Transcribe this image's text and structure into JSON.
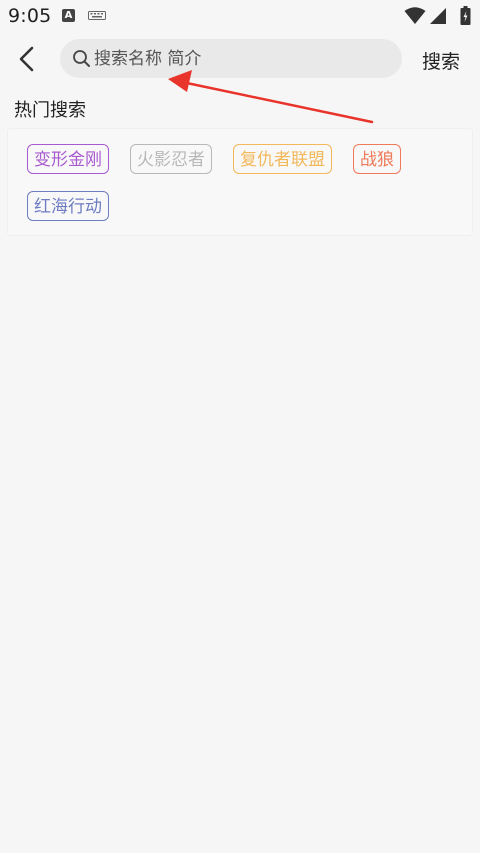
{
  "status_bar": {
    "time": "9:05",
    "notif_letter": "A",
    "icons": [
      "notification-a-icon",
      "keyboard-icon",
      "wifi-icon",
      "cell-signal-icon",
      "battery-icon"
    ]
  },
  "top_bar": {
    "back_icon": "chevron-left-icon",
    "search_placeholder": "搜索名称 简介",
    "search_value": "",
    "search_button": "搜索"
  },
  "hot_search": {
    "title": "热门搜索",
    "tags": [
      {
        "label": "变形金刚",
        "color": "#a85ad0"
      },
      {
        "label": "火影忍者",
        "color": "#b8b8b8"
      },
      {
        "label": "复仇者联盟",
        "color": "#f2b85a"
      },
      {
        "label": "战狼",
        "color": "#ef7a5a"
      },
      {
        "label": "红海行动",
        "color": "#6e7cc2"
      }
    ]
  },
  "colors": {
    "background": "#f6f6f6",
    "search_bg": "#e9e9e9",
    "annotation_arrow": "#e8342a"
  }
}
